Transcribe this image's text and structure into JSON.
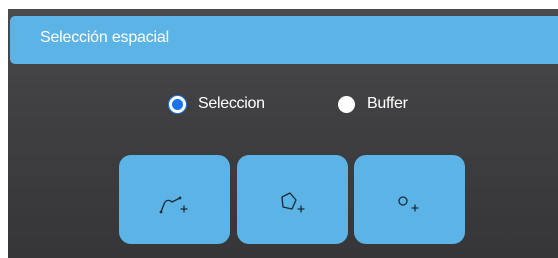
{
  "panel": {
    "title": "Selección espacial"
  },
  "mode": {
    "options": [
      {
        "label": "Seleccion",
        "selected": true
      },
      {
        "label": "Buffer",
        "selected": false
      }
    ]
  },
  "tools": [
    {
      "icon": "draw-line-icon"
    },
    {
      "icon": "draw-polygon-icon"
    },
    {
      "icon": "draw-point-icon"
    }
  ],
  "colors": {
    "accent": "#5cb3e6",
    "panel_background": "#404042",
    "radio_selected": "#1a73e8"
  }
}
